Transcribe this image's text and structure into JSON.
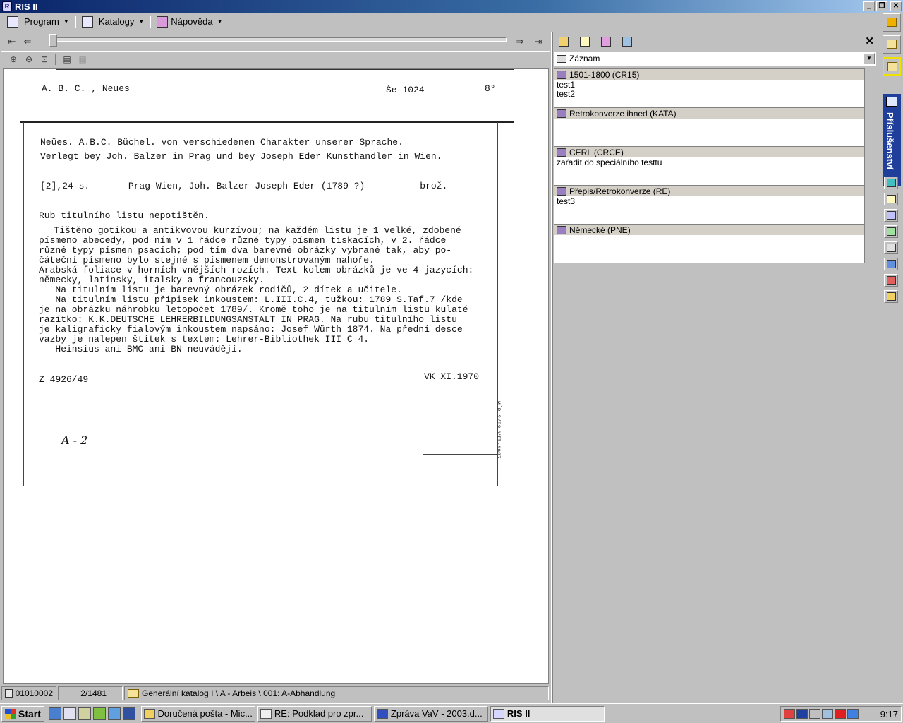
{
  "window": {
    "title": "RIS II",
    "buttons": [
      "_",
      "❐",
      "✕"
    ]
  },
  "menu": [
    {
      "label": "Program",
      "icon": "program-icon"
    },
    {
      "label": "Katalogy",
      "icon": "catalog-icon"
    },
    {
      "label": "Nápověda",
      "icon": "help-book-icon"
    }
  ],
  "sidebar": {
    "accessories_label": "Příslušenství"
  },
  "navigation": {
    "first": "⇤",
    "prev": "⇐",
    "next": "⇒",
    "last": "⇥",
    "page_position": 0.0
  },
  "card": {
    "header_left": "A. B. C. , Neues",
    "header_shelf": "Še 1024",
    "header_format": "8°",
    "lines": [
      "Neües. A.B.C. Büchel. von verschiedenen Charakter unserer Sprache.",
      "Verlegt bey Joh. Balzer in Prag und bey Joseph Eder Kunsthandler in Wien.",
      "[2],24 s.       Prag-Wien, Joh. Balzer-Joseph Eder (1789 ?)          brož.",
      "Rub titulního listu nepotištěn.",
      "   Tištěno gotikou a antikvovou kurzívou; na každém listu je 1 velké, zdobené",
      "písmeno abecedy, pod ním v 1 řádce různé typy písmen tiskacích, v 2. řádce",
      "různé typy písmen psacích; pod tím dva barevné obrázky vybrané tak, aby po-",
      "čáteční písmeno bylo stejné s písmenem demonstrovaným nahoře.",
      "Arabská foliace v horních vnějších rozích. Text kolem obrázků je ve 4 jazycích:",
      "německy, latinsky, italsky a francouzsky.",
      "   Na titulním listu je barevný obrázek rodičů, 2 dítek a učitele.",
      "   Na titulním listu přípisek inkoustem: L.III.C.4, tužkou: 1789 S.Taf.7 /kde",
      "je na obrázku náhrobku letopočet 1789/. Kromě toho je na titulním listu kulaté",
      "razítko: K.K.DEUTSCHE LEHRERBILDUNGSANSTALT IN PRAG. Na rubu titulního listu",
      "je kaligraficky fialovým inkoustem napsáno: Josef Würth 1874. Na přední desce",
      "vazby je nalepen štítek s textem: Lehrer-Bibliothek III C 4.",
      "   Heinsius ani BMC ani BN neuvádějí."
    ],
    "footer_left": "Z 4926/49",
    "footer_right": "VK XI.1970",
    "handwritten": "A - 2",
    "side_stamp": "MÚP 2/83 VII-1987"
  },
  "statusbar": {
    "record_id": "01010002",
    "position": "2/1481",
    "path": "Generální katalog I \\ A - Arbeis \\ 001: A-Abhandlung"
  },
  "record_panel": {
    "selector_label": "Záznam",
    "groups": [
      {
        "title": "1501-1800 (CR15)",
        "items": [
          "test1",
          "test2"
        ]
      },
      {
        "title": "Retrokonverze ihned (KATA)",
        "items": []
      },
      {
        "title": "CERL (CRCE)",
        "items": [
          "zařadit do speciálního testtu"
        ]
      },
      {
        "title": "Přepis/Retrokonverze (RE)",
        "items": [
          "test3"
        ]
      },
      {
        "title": "Německé (PNE)",
        "items": []
      }
    ]
  },
  "taskbar": {
    "start": "Start",
    "tasks": [
      {
        "label": "Doručená pošta - Mic...",
        "active": false
      },
      {
        "label": "RE: Podklad pro zpr...",
        "active": false
      },
      {
        "label": "Zpráva VaV - 2003.d...",
        "active": false
      },
      {
        "label": "RIS II",
        "active": true
      }
    ],
    "clock": "9:17"
  }
}
